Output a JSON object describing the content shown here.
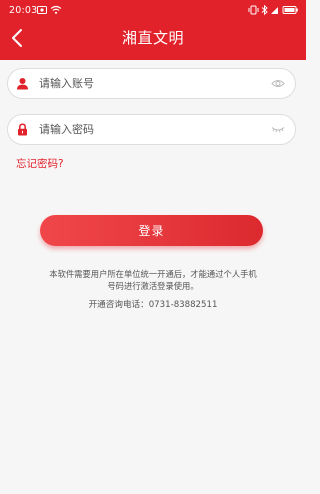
{
  "status_bar": {
    "time": "20:03"
  },
  "header": {
    "title": "湘直文明",
    "back_icon": "chevron-left-icon"
  },
  "login_form": {
    "account_placeholder": "请输入账号",
    "password_placeholder": "请输入密码",
    "forgot_password": "忘记密码?",
    "login_button": "登录"
  },
  "footer": {
    "notice": "本软件需要用户所在单位统一开通后，才能通过个人手机号码进行激活登录使用。",
    "hotline": "开通咨询电话：0731-83882511"
  },
  "colors": {
    "brand_red": "#e1222b",
    "background": "#f7f6f6"
  }
}
